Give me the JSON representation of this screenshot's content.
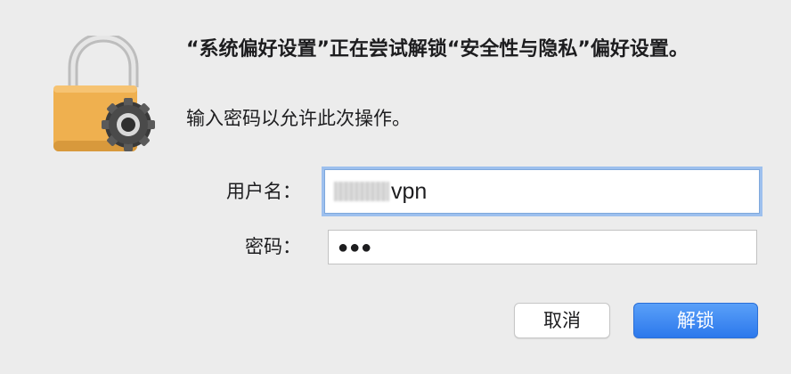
{
  "dialog": {
    "title": "“系统偏好设置”正在尝试解锁“安全性与隐私”偏好设置。",
    "subtitle": "输入密码以允许此次操作。"
  },
  "form": {
    "username_label": "用户名：",
    "username_value_visible": "vpn",
    "password_label": "密码：",
    "password_masked": "●●●"
  },
  "buttons": {
    "cancel_label": "取消",
    "unlock_label": "解锁"
  },
  "icons": {
    "lock": "padlock-with-gear-icon"
  },
  "colors": {
    "background": "#ececec",
    "lock_body": "#f0b24f",
    "accent_blue": "#2c78ec",
    "focus_ring": "#9dc0ee"
  }
}
